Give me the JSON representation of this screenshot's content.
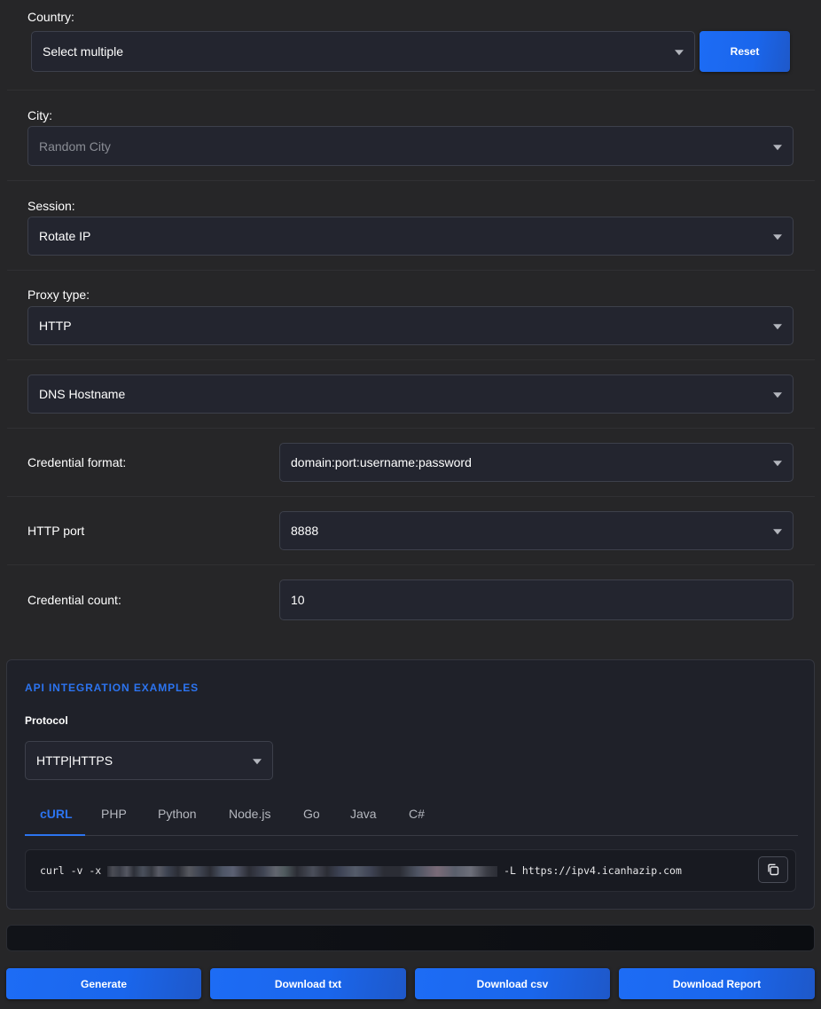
{
  "country": {
    "label": "Country:",
    "value": "Select multiple",
    "reset_label": "Reset"
  },
  "city": {
    "label": "City:",
    "value": "Random City"
  },
  "session": {
    "label": "Session:",
    "value": "Rotate IP"
  },
  "proxy_type": {
    "label": "Proxy type:",
    "value": "HTTP"
  },
  "dns": {
    "value": "DNS Hostname"
  },
  "credential_format": {
    "label": "Credential format:",
    "value": "domain:port:username:password"
  },
  "http_port": {
    "label": "HTTP port",
    "value": "8888"
  },
  "credential_count": {
    "label": "Credential count:",
    "value": "10"
  },
  "api": {
    "title": "API INTEGRATION EXAMPLES",
    "protocol_label": "Protocol",
    "protocol_value": "HTTP|HTTPS",
    "tabs": [
      "cURL",
      "PHP",
      "Python",
      "Node.js",
      "Go",
      "Java",
      "C#"
    ],
    "active_tab": "cURL",
    "code_prefix": "curl -v -x ",
    "code_suffix": " -L https://ipv4.icanhazip.com"
  },
  "actions": {
    "generate": "Generate",
    "download_txt": "Download txt",
    "download_csv": "Download csv",
    "download_report": "Download Report"
  },
  "colors": {
    "background": "#262628",
    "accent": "#2c74f0",
    "button": "#1d6cf5"
  },
  "icons": {
    "copy": "copy-icon",
    "caret": "chevron-down-icon"
  }
}
